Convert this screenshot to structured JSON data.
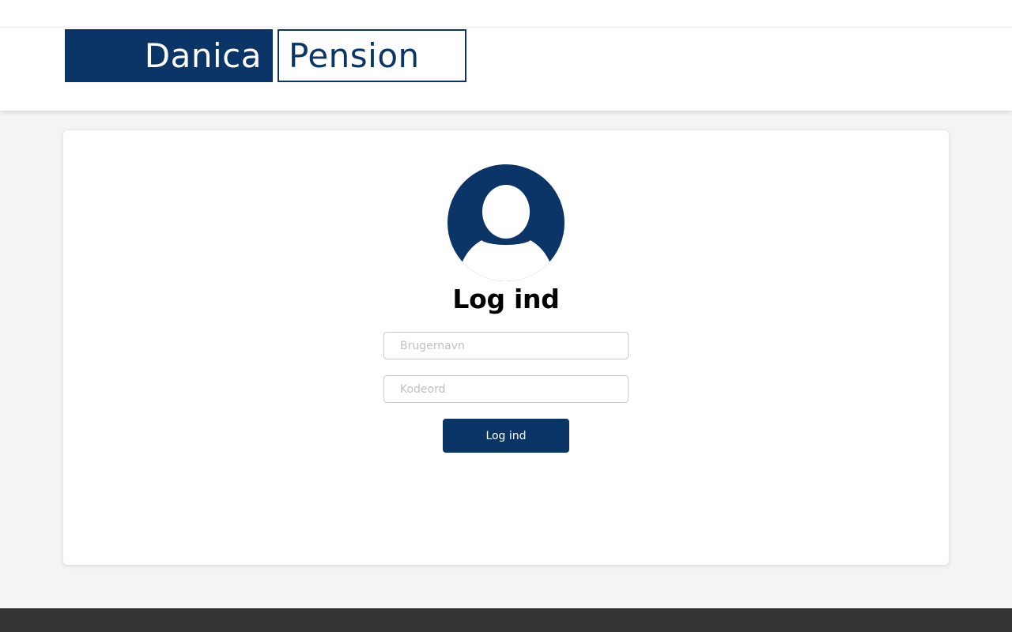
{
  "brand": {
    "logo_left": "Danica",
    "logo_right": "Pension",
    "primary_color": "#0b3567"
  },
  "login": {
    "avatar_icon": "user-avatar-icon",
    "title": "Log ind",
    "username_placeholder": "Brugernavn",
    "username_value": "",
    "password_placeholder": "Kodeord",
    "password_value": "",
    "submit_label": "Log ind"
  }
}
